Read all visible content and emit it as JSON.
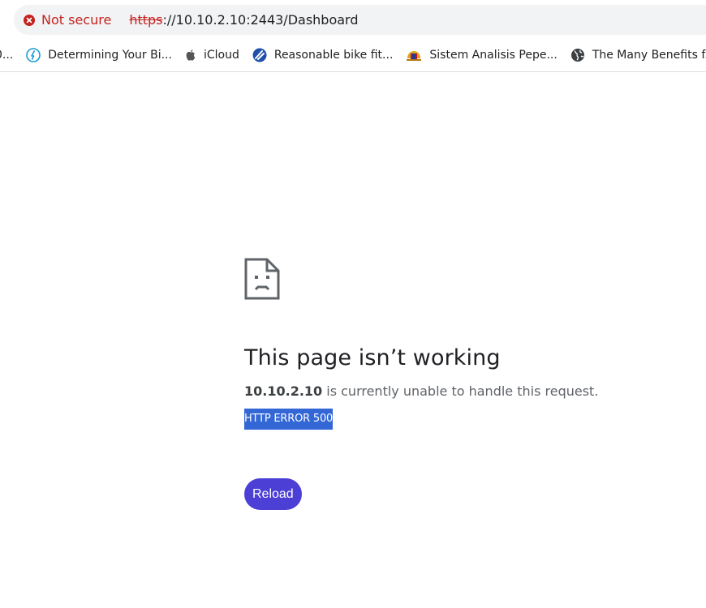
{
  "address_bar": {
    "security_label": "Not secure",
    "url_scheme": "https",
    "url_rest": "://10.10.2.10:2443/Dashboard"
  },
  "bookmarks": [
    {
      "label": "0...",
      "icon": "partial-bookmark-icon"
    },
    {
      "label": "Determining Your Bi...",
      "icon": "bike-fit-icon"
    },
    {
      "label": "iCloud",
      "icon": "apple-icon"
    },
    {
      "label": "Reasonable bike fit...",
      "icon": "bike-fit-logo-icon"
    },
    {
      "label": "Sistem Analisis Pepe...",
      "icon": "malaysia-crest-icon"
    },
    {
      "label": "The Many Benefits f...",
      "icon": "globe-icon"
    },
    {
      "label": "",
      "icon": "cisco-icon"
    }
  ],
  "error_page": {
    "title": "This page isn’t working",
    "host": "10.10.2.10",
    "message": " is currently unable to handle this request.",
    "error_code": "HTTP ERROR 500",
    "reload_label": "Reload"
  },
  "colors": {
    "insecure_red": "#c5221f",
    "reload_button": "#4b3fd6",
    "selection_highlight": "#3367d6"
  }
}
